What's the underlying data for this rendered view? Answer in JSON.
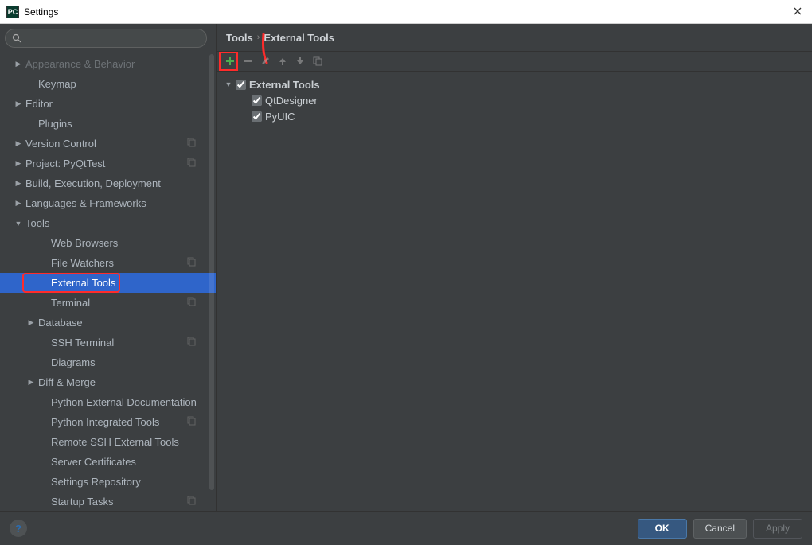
{
  "window": {
    "title": "Settings",
    "app_icon_text": "PC"
  },
  "search": {
    "placeholder": ""
  },
  "sidebar": {
    "items": [
      {
        "label": "Appearance & Behavior",
        "indent": 0,
        "arrow": "right",
        "dim": true,
        "copy": false
      },
      {
        "label": "Keymap",
        "indent": 1,
        "arrow": "none",
        "copy": false
      },
      {
        "label": "Editor",
        "indent": 0,
        "arrow": "right",
        "copy": false
      },
      {
        "label": "Plugins",
        "indent": 1,
        "arrow": "none",
        "copy": false
      },
      {
        "label": "Version Control",
        "indent": 0,
        "arrow": "right",
        "copy": true
      },
      {
        "label": "Project: PyQtTest",
        "indent": 0,
        "arrow": "right",
        "copy": true
      },
      {
        "label": "Build, Execution, Deployment",
        "indent": 0,
        "arrow": "right",
        "copy": false
      },
      {
        "label": "Languages & Frameworks",
        "indent": 0,
        "arrow": "right",
        "copy": false
      },
      {
        "label": "Tools",
        "indent": 0,
        "arrow": "down",
        "copy": false
      },
      {
        "label": "Web Browsers",
        "indent": 2,
        "arrow": "none",
        "copy": false
      },
      {
        "label": "File Watchers",
        "indent": 2,
        "arrow": "none",
        "copy": true
      },
      {
        "label": "External Tools",
        "indent": 2,
        "arrow": "none",
        "selected": true,
        "annot": true,
        "copy": false
      },
      {
        "label": "Terminal",
        "indent": 2,
        "arrow": "none",
        "copy": true
      },
      {
        "label": "Database",
        "indent": 1,
        "arrow": "right",
        "copy": false
      },
      {
        "label": "SSH Terminal",
        "indent": 2,
        "arrow": "none",
        "copy": true
      },
      {
        "label": "Diagrams",
        "indent": 2,
        "arrow": "none",
        "copy": false
      },
      {
        "label": "Diff & Merge",
        "indent": 1,
        "arrow": "right",
        "copy": false
      },
      {
        "label": "Python External Documentation",
        "indent": 2,
        "arrow": "none",
        "copy": false
      },
      {
        "label": "Python Integrated Tools",
        "indent": 2,
        "arrow": "none",
        "copy": true
      },
      {
        "label": "Remote SSH External Tools",
        "indent": 2,
        "arrow": "none",
        "copy": false
      },
      {
        "label": "Server Certificates",
        "indent": 2,
        "arrow": "none",
        "copy": false
      },
      {
        "label": "Settings Repository",
        "indent": 2,
        "arrow": "none",
        "copy": false
      },
      {
        "label": "Startup Tasks",
        "indent": 2,
        "arrow": "none",
        "copy": true
      }
    ]
  },
  "breadcrumb": {
    "root": "Tools",
    "leaf": "External Tools"
  },
  "toolbar": {
    "add": "+",
    "remove": "−",
    "edit": "edit",
    "up": "up",
    "down": "down",
    "copy": "copy"
  },
  "content_tree": {
    "group": {
      "label": "External Tools",
      "checked": true
    },
    "items": [
      {
        "label": "QtDesigner",
        "checked": true
      },
      {
        "label": "PyUIC",
        "checked": true
      }
    ]
  },
  "buttons": {
    "help": "?",
    "ok": "OK",
    "cancel": "Cancel",
    "apply": "Apply"
  }
}
